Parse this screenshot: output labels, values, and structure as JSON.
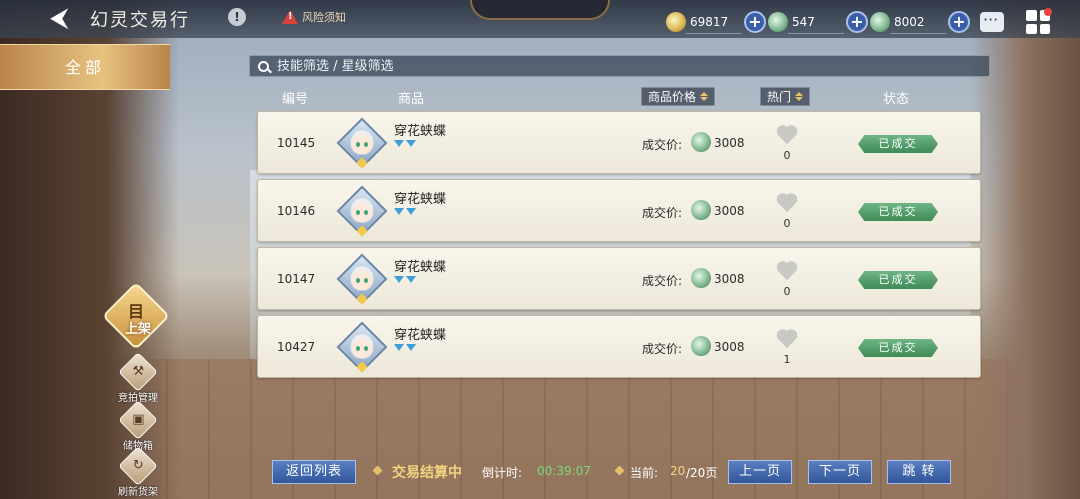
{
  "header": {
    "back_icon": "back-arrow-icon",
    "title": "幻灵交易行",
    "info_glyph": "!",
    "risk_notice": "风险须知",
    "currencies": [
      {
        "icon": "gold-coin-icon",
        "value": "69817",
        "color": "#d9b24c"
      },
      {
        "icon": "jade-dragon-icon",
        "value": "547",
        "color": "#79b38b"
      },
      {
        "icon": "jade-coin-icon",
        "value": "8002",
        "color": "#79b38b"
      }
    ],
    "plus_glyph": "+"
  },
  "sidebar": {
    "tab_all": "全部",
    "shelf_label": "上架",
    "shelf_glyph": "目",
    "items": [
      {
        "label": "竞拍管理",
        "icon": "auction-hammer-icon",
        "glyph": "⚒"
      },
      {
        "label": "储物箱",
        "icon": "storage-box-icon",
        "glyph": "▣"
      },
      {
        "label": "刷新货架",
        "icon": "refresh-icon",
        "glyph": "↻"
      }
    ]
  },
  "search": {
    "placeholder": "技能筛选 / 星级筛选"
  },
  "columns": {
    "id": "编号",
    "item": "商品",
    "price": "商品价格",
    "hot": "热门",
    "status": "状态"
  },
  "rows": [
    {
      "id": "10145",
      "name": "穿花蛱蝶",
      "price_label": "成交价:",
      "price": "3008",
      "hot": "0",
      "status": "已成交"
    },
    {
      "id": "10146",
      "name": "穿花蛱蝶",
      "price_label": "成交价:",
      "price": "3008",
      "hot": "0",
      "status": "已成交"
    },
    {
      "id": "10147",
      "name": "穿花蛱蝶",
      "price_label": "成交价:",
      "price": "3008",
      "hot": "0",
      "status": "已成交"
    },
    {
      "id": "10427",
      "name": "穿花蛱蝶",
      "price_label": "成交价:",
      "price": "3008",
      "hot": "1",
      "status": "已成交"
    }
  ],
  "footer": {
    "back_to_list": "返回列表",
    "trade_status": "交易结算中",
    "countdown_label": "倒计时:",
    "countdown": "00:39:07",
    "page_label": "当前:",
    "page_current": "20",
    "page_total": "/20页",
    "prev": "上一页",
    "next": "下一页",
    "jump": "跳 转"
  },
  "colors": {
    "accent_gold": "#e8c06a",
    "status_green": "#3d8a57",
    "button_blue": "#32559a"
  }
}
